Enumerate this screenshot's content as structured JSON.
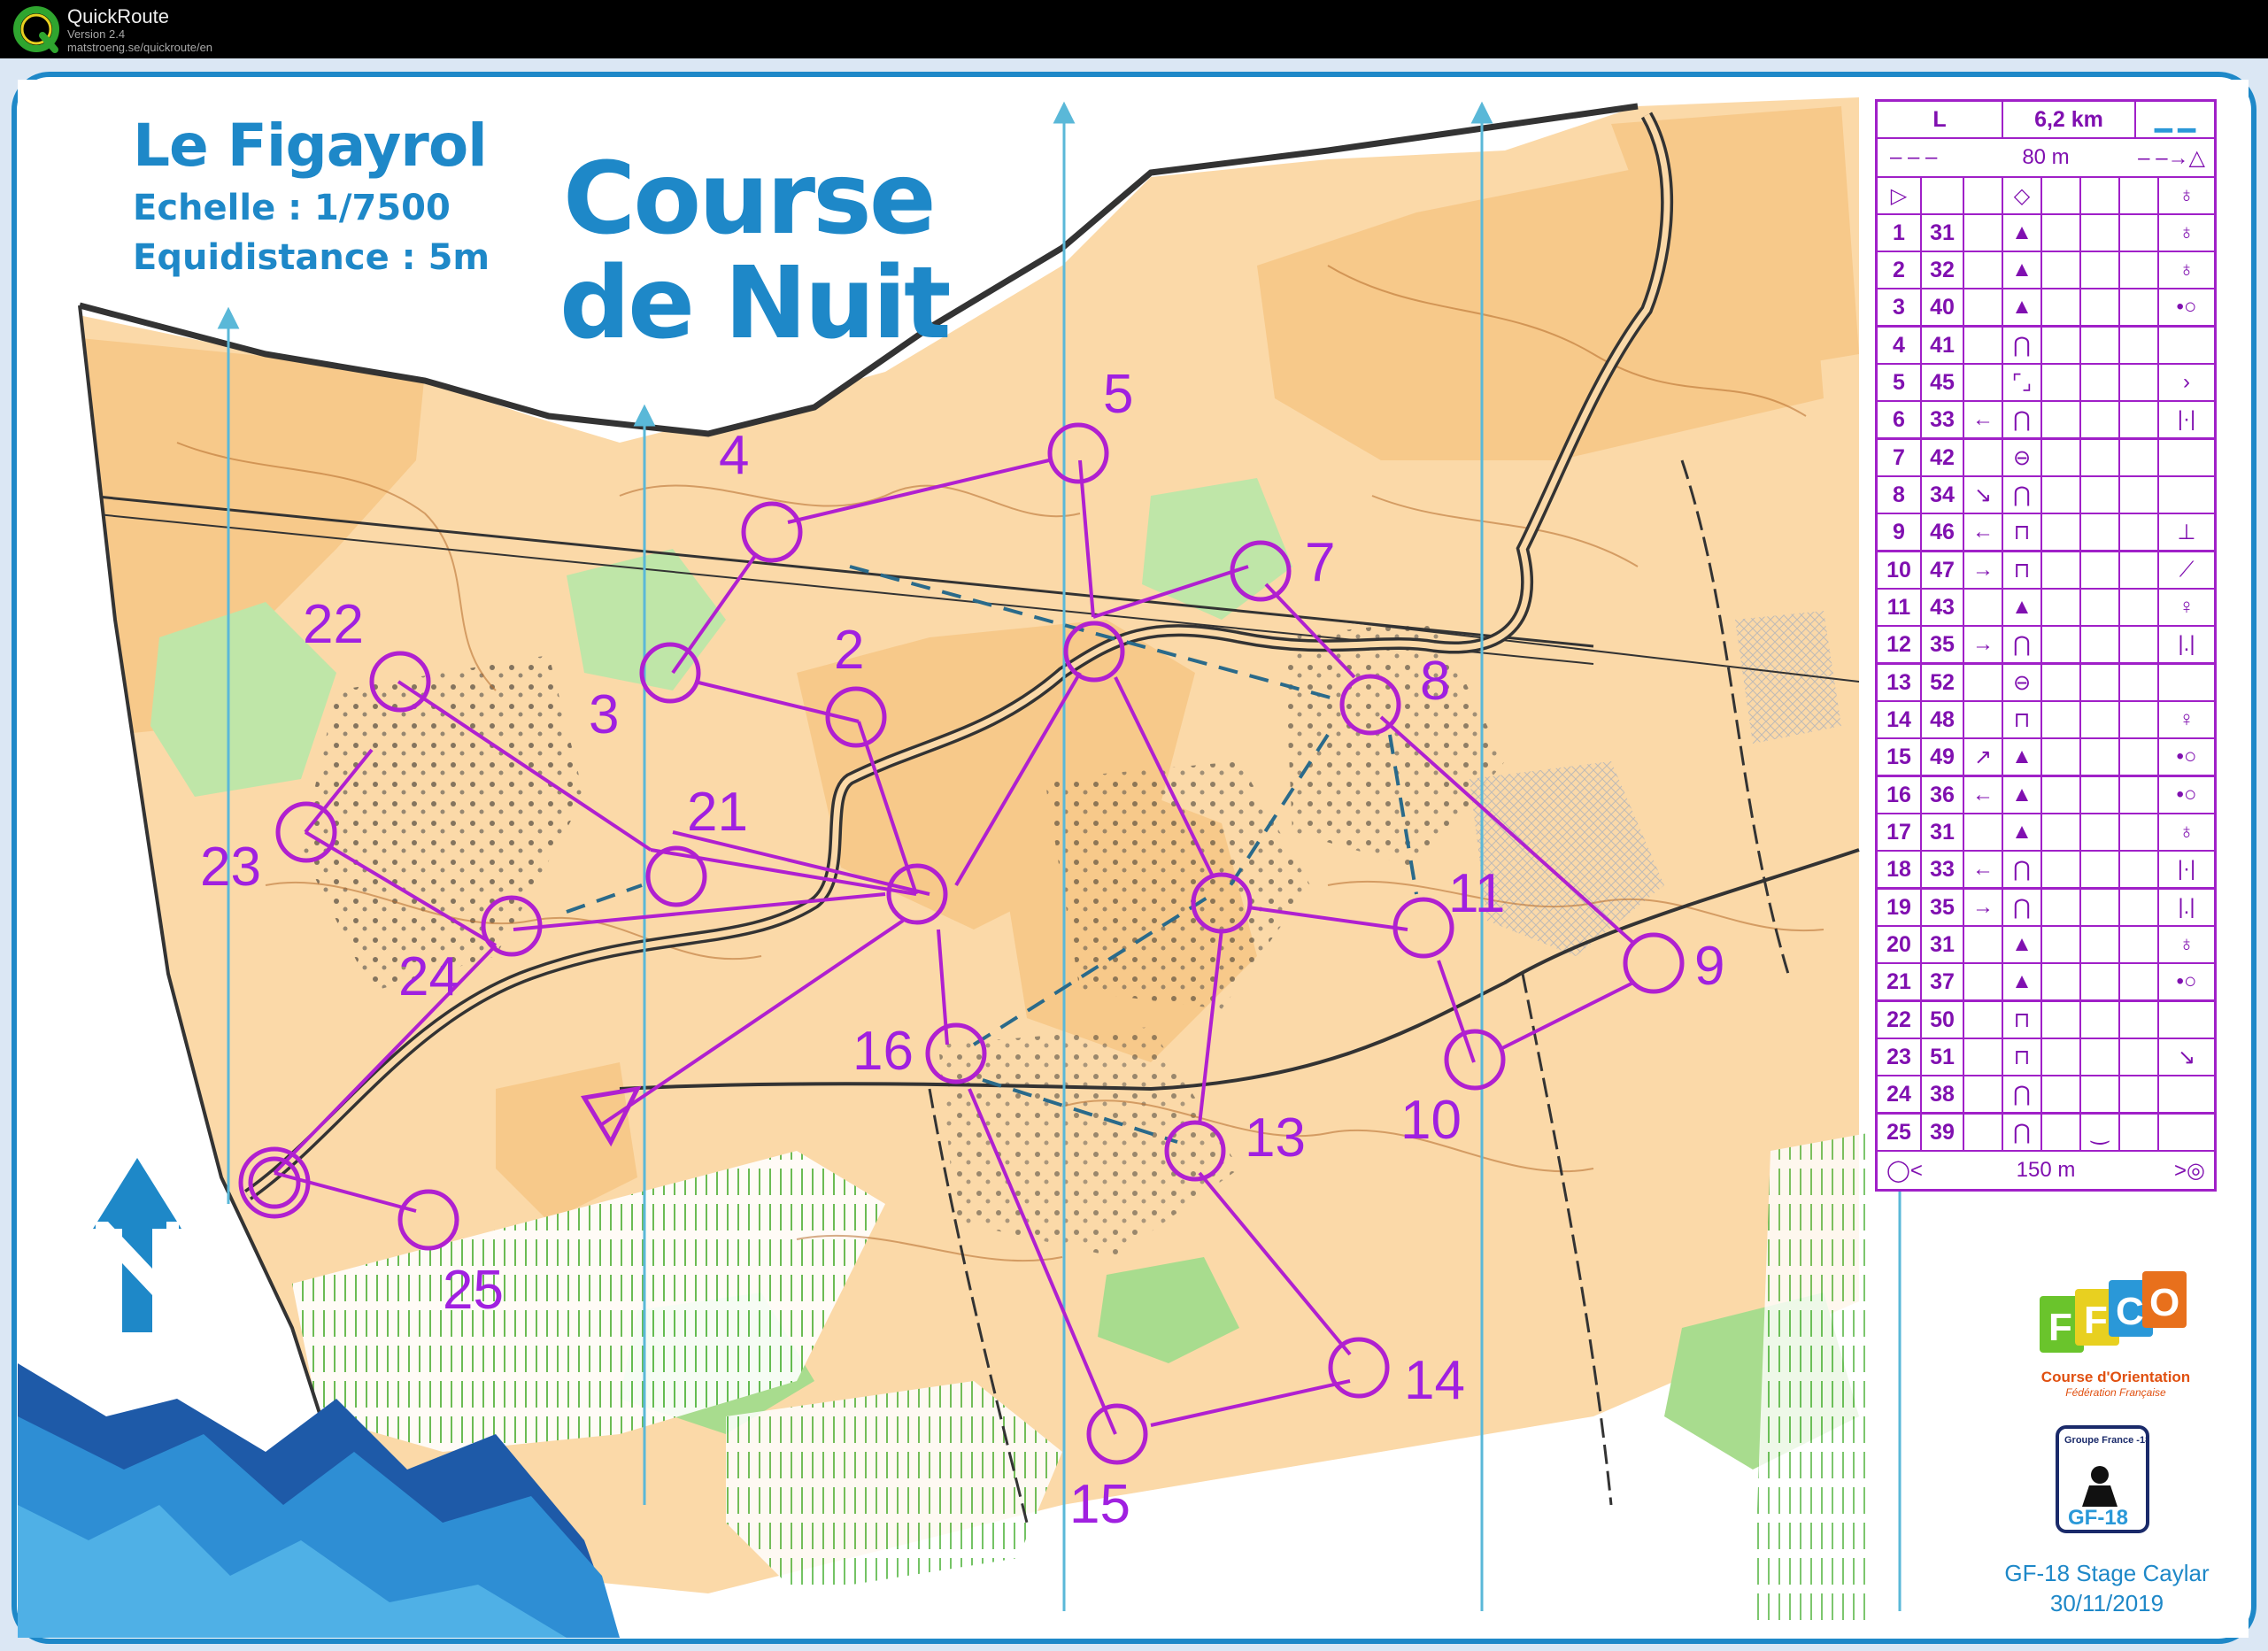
{
  "app": {
    "name": "QuickRoute",
    "version": "Version 2.4",
    "url": "matstroeng.se/quickroute/en"
  },
  "map": {
    "name": "Le Figayrol",
    "scale": "Echelle : 1/7500",
    "equidistance": "Equidistance : 5m",
    "course_title_line1": "Course",
    "course_title_line2": "de Nuit",
    "colors": {
      "course": "#b020d0",
      "open_land": "#fbd9a8",
      "rough_open": "#f9c885",
      "forest": "#ffffff",
      "green": "#8fd07a",
      "brand": "#1e88c8",
      "frame": "#dbe7f4"
    },
    "north_icon": "north-arrow-icon"
  },
  "course": {
    "controls": [
      "1",
      "2",
      "3",
      "4",
      "5",
      "6",
      "7",
      "8",
      "9",
      "10",
      "11",
      "12",
      "13",
      "14",
      "15",
      "16",
      "17",
      "18",
      "19",
      "20",
      "21",
      "22",
      "23",
      "24",
      "25"
    ]
  },
  "description_sheet": {
    "class": "L",
    "length": "6,2 km",
    "taped_route_start": "80 m",
    "taped_route_finish": "150 m",
    "rows": [
      {
        "n": "1",
        "code": "31",
        "dir": "",
        "feat": "▲",
        "detail": "",
        "pos": "♁"
      },
      {
        "n": "2",
        "code": "32",
        "dir": "",
        "feat": "▲",
        "detail": "",
        "pos": "♁"
      },
      {
        "n": "3",
        "code": "40",
        "dir": "",
        "feat": "▲",
        "detail": "",
        "pos": "•○"
      },
      {
        "n": "4",
        "code": "41",
        "dir": "",
        "feat": "⋂",
        "detail": "",
        "pos": ""
      },
      {
        "n": "5",
        "code": "45",
        "dir": "",
        "feat": "⌜⌟",
        "detail": "",
        "pos": "›"
      },
      {
        "n": "6",
        "code": "33",
        "dir": "←",
        "feat": "⋂",
        "detail": "",
        "pos": "|·|"
      },
      {
        "n": "7",
        "code": "42",
        "dir": "",
        "feat": "⊖",
        "detail": "",
        "pos": ""
      },
      {
        "n": "8",
        "code": "34",
        "dir": "↘",
        "feat": "⋂",
        "detail": "",
        "pos": ""
      },
      {
        "n": "9",
        "code": "46",
        "dir": "←",
        "feat": "⊓",
        "detail": "",
        "pos": "⊥"
      },
      {
        "n": "10",
        "code": "47",
        "dir": "→",
        "feat": "⊓",
        "detail": "",
        "pos": "⟋"
      },
      {
        "n": "11",
        "code": "43",
        "dir": "",
        "feat": "▲",
        "detail": "",
        "pos": "♀"
      },
      {
        "n": "12",
        "code": "35",
        "dir": "→",
        "feat": "⋂",
        "detail": "",
        "pos": "|.|"
      },
      {
        "n": "13",
        "code": "52",
        "dir": "",
        "feat": "⊖",
        "detail": "",
        "pos": ""
      },
      {
        "n": "14",
        "code": "48",
        "dir": "",
        "feat": "⊓",
        "detail": "",
        "pos": "♀"
      },
      {
        "n": "15",
        "code": "49",
        "dir": "↗",
        "feat": "▲",
        "detail": "",
        "pos": "•○"
      },
      {
        "n": "16",
        "code": "36",
        "dir": "←",
        "feat": "▲",
        "detail": "",
        "pos": "•○"
      },
      {
        "n": "17",
        "code": "31",
        "dir": "",
        "feat": "▲",
        "detail": "",
        "pos": "♁"
      },
      {
        "n": "18",
        "code": "33",
        "dir": "←",
        "feat": "⋂",
        "detail": "",
        "pos": "|·|"
      },
      {
        "n": "19",
        "code": "35",
        "dir": "→",
        "feat": "⋂",
        "detail": "",
        "pos": "|.|"
      },
      {
        "n": "20",
        "code": "31",
        "dir": "",
        "feat": "▲",
        "detail": "",
        "pos": "♁"
      },
      {
        "n": "21",
        "code": "37",
        "dir": "",
        "feat": "▲",
        "detail": "",
        "pos": "•○"
      },
      {
        "n": "22",
        "code": "50",
        "dir": "",
        "feat": "⊓",
        "detail": "",
        "pos": ""
      },
      {
        "n": "23",
        "code": "51",
        "dir": "",
        "feat": "⊓",
        "detail": "",
        "pos": "↘"
      },
      {
        "n": "24",
        "code": "38",
        "dir": "",
        "feat": "⋂",
        "detail": "",
        "pos": ""
      },
      {
        "n": "25",
        "code": "39",
        "dir": "",
        "feat": "⋂",
        "detail": "‿",
        "pos": ""
      }
    ]
  },
  "branding": {
    "ffco_logo_text": "FFCO",
    "ffco_name": "Course d'Orientation",
    "ffco_sub": "Fédération Française",
    "gf18_top": "Groupe France -18",
    "gf18_logo_text": "GF-18",
    "stage_name": "GF-18 Stage Caylar",
    "stage_date": "30/11/2019"
  }
}
